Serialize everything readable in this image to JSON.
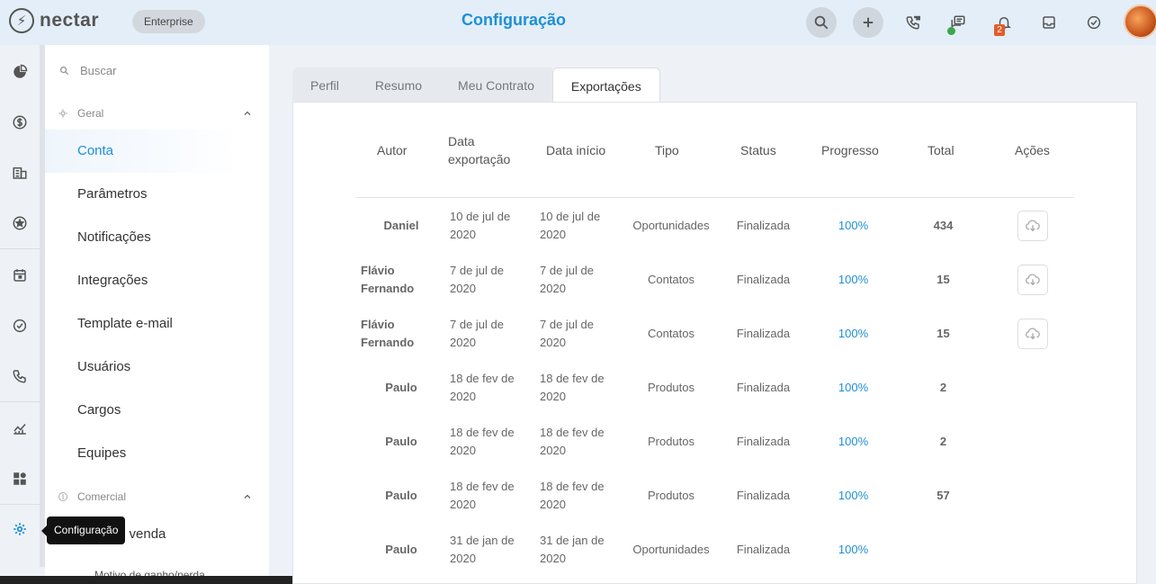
{
  "brand": {
    "name": "nectar",
    "plan": "Enterprise"
  },
  "header": {
    "title": "Configuração",
    "icons": [
      "search-icon",
      "plus-icon",
      "phone-dialpad-icon",
      "chat-icon",
      "bell-icon",
      "inbox-icon",
      "check-circle-icon"
    ],
    "notification_count": "2"
  },
  "rail": {
    "items": [
      "pie-chart-icon",
      "dollar-icon",
      "building-icon",
      "star-icon",
      "calendar-icon",
      "check-circle-icon",
      "phone-icon",
      "analytics-icon",
      "dashboard-icon",
      "gear-icon"
    ],
    "tooltip": "Configuração"
  },
  "menu": {
    "search_placeholder": "Buscar",
    "groups": [
      {
        "label": "Geral",
        "items": [
          "Conta",
          "Parâmetros",
          "Notificações",
          "Integrações",
          "Template e-mail",
          "Usuários",
          "Cargos",
          "Equipes"
        ]
      },
      {
        "label": "Comercial",
        "items": [
          "Funil de venda",
          "Motivo de ganho/perda"
        ]
      }
    ],
    "active": "Conta"
  },
  "tabs": [
    "Perfil",
    "Resumo",
    "Meu Contrato",
    "Exportações"
  ],
  "active_tab": "Exportações",
  "table": {
    "headers": [
      "Autor",
      "Data exportação",
      "Data início",
      "Tipo",
      "Status",
      "Progresso",
      "Total",
      "Ações"
    ],
    "rows": [
      {
        "author": "Daniel",
        "export_date": "10 de jul de 2020",
        "start_date": "10 de jul de 2020",
        "type": "Oportunidades",
        "status": "Finalizada",
        "progress": "100%",
        "total": "434",
        "download": true
      },
      {
        "author": "Flávio Fernando",
        "export_date": "7 de jul de 2020",
        "start_date": "7 de jul de 2020",
        "type": "Contatos",
        "status": "Finalizada",
        "progress": "100%",
        "total": "15",
        "download": true
      },
      {
        "author": "Flávio Fernando",
        "export_date": "7 de jul de 2020",
        "start_date": "7 de jul de 2020",
        "type": "Contatos",
        "status": "Finalizada",
        "progress": "100%",
        "total": "15",
        "download": true
      },
      {
        "author": "Paulo",
        "export_date": "18 de fev de 2020",
        "start_date": "18 de fev de 2020",
        "type": "Produtos",
        "status": "Finalizada",
        "progress": "100%",
        "total": "2",
        "download": false
      },
      {
        "author": "Paulo",
        "export_date": "18 de fev de 2020",
        "start_date": "18 de fev de 2020",
        "type": "Produtos",
        "status": "Finalizada",
        "progress": "100%",
        "total": "2",
        "download": false
      },
      {
        "author": "Paulo",
        "export_date": "18 de fev de 2020",
        "start_date": "18 de fev de 2020",
        "type": "Produtos",
        "status": "Finalizada",
        "progress": "100%",
        "total": "57",
        "download": false
      },
      {
        "author": "Paulo",
        "export_date": "31 de jan de 2020",
        "start_date": "31 de jan de 2020",
        "type": "Oportunidades",
        "status": "Finalizada",
        "progress": "100%",
        "total": "",
        "download": false
      }
    ]
  },
  "colors": {
    "accent": "#1e8fd6",
    "badge": "#e35d2b",
    "online": "#3ca64a"
  }
}
